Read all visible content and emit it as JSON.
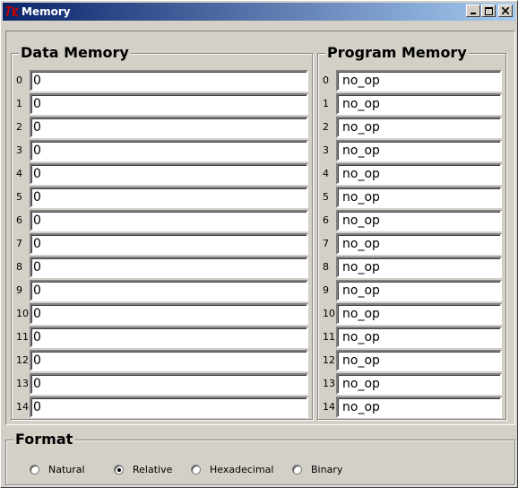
{
  "window": {
    "title": "Memory",
    "app_icon": "tk-icon",
    "controls": [
      "minimize-icon",
      "maximize-icon",
      "close-icon"
    ]
  },
  "data_memory": {
    "title": "Data Memory",
    "rows": [
      {
        "index": "0",
        "value": "0"
      },
      {
        "index": "1",
        "value": "0"
      },
      {
        "index": "2",
        "value": "0"
      },
      {
        "index": "3",
        "value": "0"
      },
      {
        "index": "4",
        "value": "0"
      },
      {
        "index": "5",
        "value": "0"
      },
      {
        "index": "6",
        "value": "0"
      },
      {
        "index": "7",
        "value": "0"
      },
      {
        "index": "8",
        "value": "0"
      },
      {
        "index": "9",
        "value": "0"
      },
      {
        "index": "10",
        "value": "0"
      },
      {
        "index": "11",
        "value": "0"
      },
      {
        "index": "12",
        "value": "0"
      },
      {
        "index": "13",
        "value": "0"
      },
      {
        "index": "14",
        "value": "0"
      }
    ]
  },
  "program_memory": {
    "title": "Program Memory",
    "rows": [
      {
        "index": "0",
        "value": "no_op"
      },
      {
        "index": "1",
        "value": "no_op"
      },
      {
        "index": "2",
        "value": "no_op"
      },
      {
        "index": "3",
        "value": "no_op"
      },
      {
        "index": "4",
        "value": "no_op"
      },
      {
        "index": "5",
        "value": "no_op"
      },
      {
        "index": "6",
        "value": "no_op"
      },
      {
        "index": "7",
        "value": "no_op"
      },
      {
        "index": "8",
        "value": "no_op"
      },
      {
        "index": "9",
        "value": "no_op"
      },
      {
        "index": "10",
        "value": "no_op"
      },
      {
        "index": "11",
        "value": "no_op"
      },
      {
        "index": "12",
        "value": "no_op"
      },
      {
        "index": "13",
        "value": "no_op"
      },
      {
        "index": "14",
        "value": "no_op"
      }
    ]
  },
  "format": {
    "title": "Format",
    "selected": "Relative",
    "options": [
      "Natural",
      "Relative",
      "Hexadecimal",
      "Binary"
    ]
  }
}
